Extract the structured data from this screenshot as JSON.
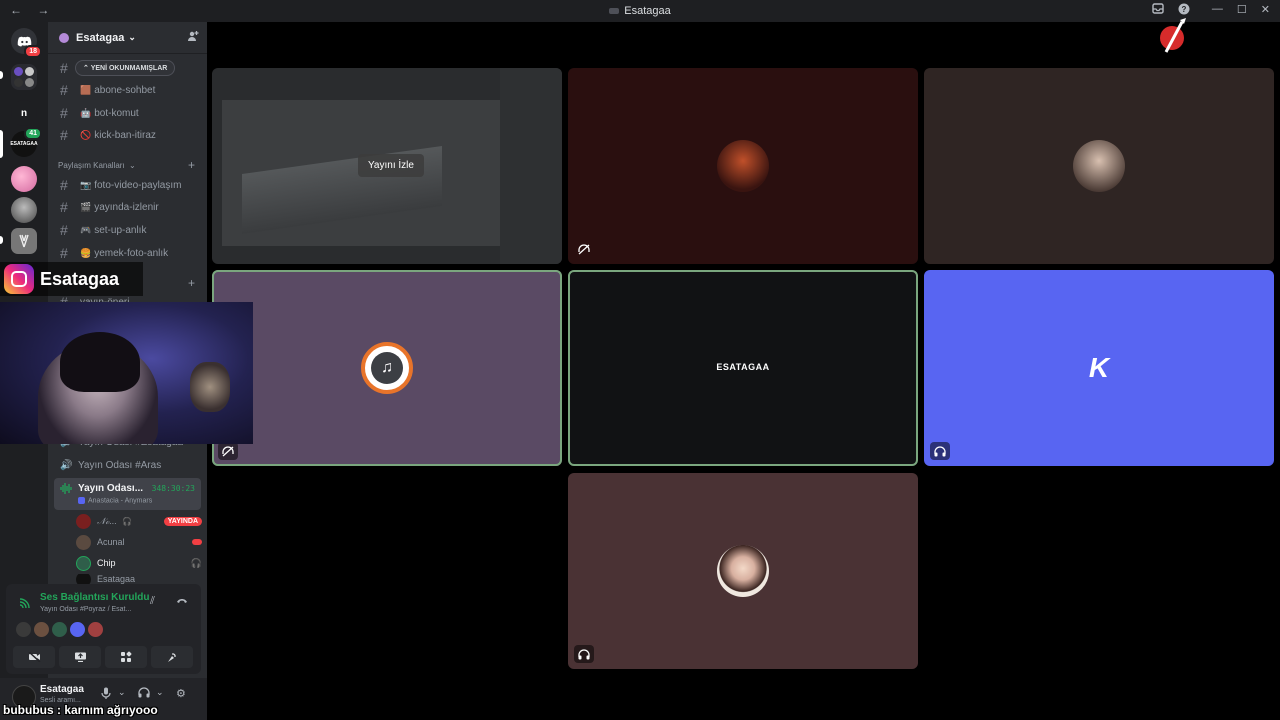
{
  "window": {
    "title": "Esatagaa",
    "nav_back": "←",
    "nav_forward": "→",
    "inbox_icon": "inbox-icon",
    "help_icon": "help-icon",
    "minimize": "—",
    "maximize": "☐",
    "close": "✕"
  },
  "guilds": [
    {
      "label": "",
      "badge": "18",
      "icon": "discord-logo-icon",
      "color": "#5865f2"
    },
    {
      "label": "",
      "icon": "server-group-icon",
      "color": "#313338"
    },
    {
      "label": "n",
      "icon": "server-n-icon",
      "color": "#1e1f22"
    },
    {
      "label": "ESATAGAA",
      "badge": "41",
      "icon": "server-esatagaa-icon",
      "color": "#111"
    },
    {
      "label": "",
      "icon": "server-anime-icon",
      "color": "#d46aa0"
    },
    {
      "label": "",
      "icon": "server-character-icon",
      "color": "#6b6b6b"
    },
    {
      "label": "",
      "icon": "server-x-icon",
      "color": "#777"
    }
  ],
  "server": {
    "name": "Esatagaa",
    "unread_pill": "YENİ OKUNMAMIŞLAR",
    "channels_top": [
      {
        "emoji": "🟫",
        "name": "abone-sohbet"
      },
      {
        "emoji": "🤖",
        "name": "bot-komut"
      },
      {
        "emoji": "🚫",
        "name": "kick-ban-itiraz"
      }
    ],
    "category": "Paylaşım Kanalları",
    "channels_share": [
      {
        "emoji": "📷",
        "name": "foto-video-paylaşım"
      },
      {
        "emoji": "🎬",
        "name": "yayında-izlenir"
      },
      {
        "emoji": "🎮",
        "name": "set-up-anlık"
      },
      {
        "emoji": "🍔",
        "name": "yemek-foto-anlık"
      }
    ],
    "hidden_channel": "yayın-öneri",
    "voice_channels": [
      {
        "name": "Yayın Odası #Esatagaa"
      },
      {
        "name": "Yayın Odası #Aras"
      }
    ],
    "active_voice": {
      "name": "Yayın Odası...",
      "time": "348:30:23",
      "sub": "Anastacia - Anymars"
    },
    "voice_users": [
      {
        "name": "𝒩ℴ...",
        "live": "YAYINDA",
        "color": "#7a1f1f"
      },
      {
        "name": "Acunal",
        "color": "#5a4a40"
      },
      {
        "name": "Chip",
        "color": "#2f5e4a"
      },
      {
        "name": "Esatagaa",
        "color": "#111"
      }
    ]
  },
  "voice_panel": {
    "status": "Ses Bağlantısı Kuruldu",
    "sub": "Yayın Odası #Poyraz / Esat...",
    "buttons": [
      "camera-off-icon",
      "screen-share-icon",
      "activities-icon",
      "soundboard-icon"
    ],
    "participants": [
      "#3a3a3a",
      "#6b5040",
      "#2f5e4a",
      "#5865f2",
      "#a04040"
    ]
  },
  "user": {
    "name": "Esatagaa",
    "status": "Sesli aramı..."
  },
  "tiles": [
    {
      "id": "stream",
      "watch_label": "Yayını İzle"
    },
    {
      "id": "red-user",
      "color": "#2a0f0f"
    },
    {
      "id": "face-user",
      "color": "#2f2523"
    },
    {
      "id": "music-bot",
      "color": "#5a4a64"
    },
    {
      "id": "esatagaa",
      "label": "ESATAGAA",
      "color": "#111214"
    },
    {
      "id": "k-user",
      "label": "K",
      "color": "#5865f2"
    },
    {
      "id": "anime-user",
      "color": "#4a3234"
    }
  ],
  "overlay": {
    "instagram_handle": "Esatagaa",
    "chat_message": "bububus : karnım ağrıyooo"
  }
}
